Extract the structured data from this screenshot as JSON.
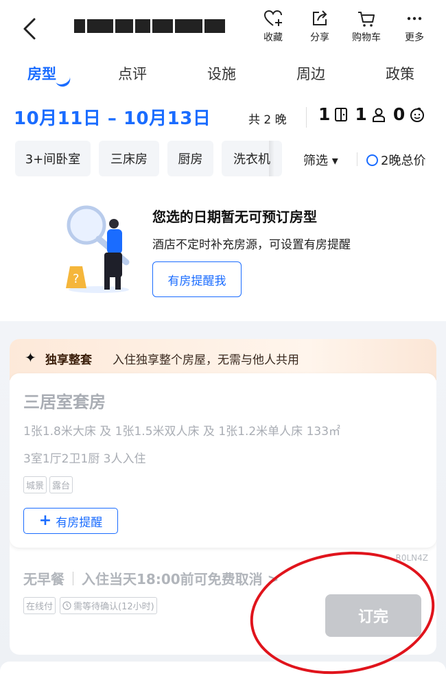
{
  "header": {
    "back_icon": "chevron-left-icon",
    "title_blurred": true,
    "actions": [
      {
        "label": "收藏",
        "icon": "heart-plus-icon"
      },
      {
        "label": "分享",
        "icon": "share-icon"
      },
      {
        "label": "购物车",
        "icon": "cart-icon"
      },
      {
        "label": "更多",
        "icon": "more-icon"
      }
    ]
  },
  "tabs": [
    "房型",
    "点评",
    "设施",
    "周边",
    "政策"
  ],
  "dates": {
    "range": "10月11日 – 10月13日",
    "nights": "共 2 晚",
    "rooms": "1",
    "adults": "1",
    "children": "0"
  },
  "filters": {
    "chips": [
      "3+间卧室",
      "三床房",
      "厨房",
      "洗衣机"
    ],
    "select_label": "筛选 ▾",
    "price_toggle": "2晚总价"
  },
  "empty_state": {
    "title": "您选的日期暂无可预订房型",
    "subtitle": "酒店不定时补充房源，可设置有房提醒",
    "button": "有房提醒我"
  },
  "room": {
    "exclusive_title": "独享整套",
    "exclusive_desc": "入住独享整个房屋，无需与他人共用",
    "name": "三居室套房",
    "beds": "1张1.8米大床 及 1张1.5米双人床 及 1张1.2米单人床  133㎡",
    "layout": "3室1厅2卫1厨  3人入住",
    "tags": [
      "城景",
      "露台"
    ],
    "remind_button": "有房提醒",
    "code": "R0LN4Z",
    "meal": "无早餐",
    "cancel_policy": "入住当天18:00前可免费取消 >",
    "rate_tags": [
      "在线付",
      "需等待确认(12小时)"
    ],
    "book_button": "订完"
  },
  "colors": {
    "accent": "#1a6cff",
    "disabled": "#c6c8cc",
    "annotation": "#e0141c"
  }
}
